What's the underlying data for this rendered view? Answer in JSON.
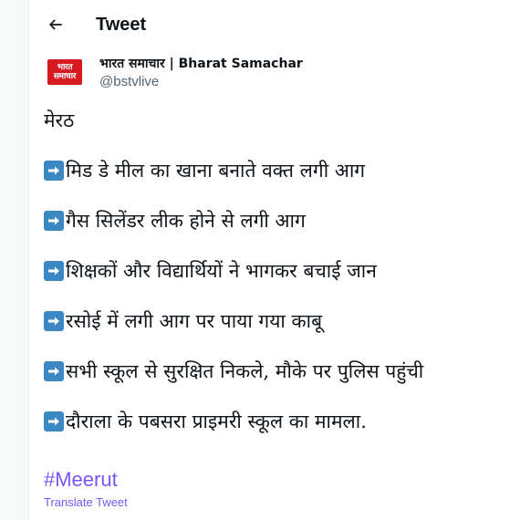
{
  "header": {
    "title": "Tweet",
    "back_icon": "arrow-left-icon"
  },
  "author": {
    "display_name": "भारत समाचार | Bharat Samachar",
    "handle": "@bstvlive",
    "avatar_logo_text": "भारत समाचार",
    "avatar_color": "#d71920"
  },
  "tweet": {
    "city": "मेरठ",
    "bullet_icon": "right-arrow-emoji-icon",
    "bullet_color": "#3b88c3",
    "items": [
      "मिड डे मील का खाना बनाते वक्त लगी आग",
      "गैस सिलेंडर लीक होने से लगी आग",
      "शिक्षकों और विद्यार्थियों ने भागकर बचाई जान",
      "रसोई में लगी आग पर पाया गया काबू",
      "सभी स्कूल से सुरक्षित निकले, मौके पर पुलिस पहुंची",
      "दौराला के पबसरा प्राइमरी स्कूल का मामला."
    ],
    "hashtag": "#Meerut",
    "translate_label": "Translate Tweet"
  },
  "colors": {
    "link": "#7856ff",
    "secondary_text": "#536471",
    "text": "#0f1419"
  }
}
